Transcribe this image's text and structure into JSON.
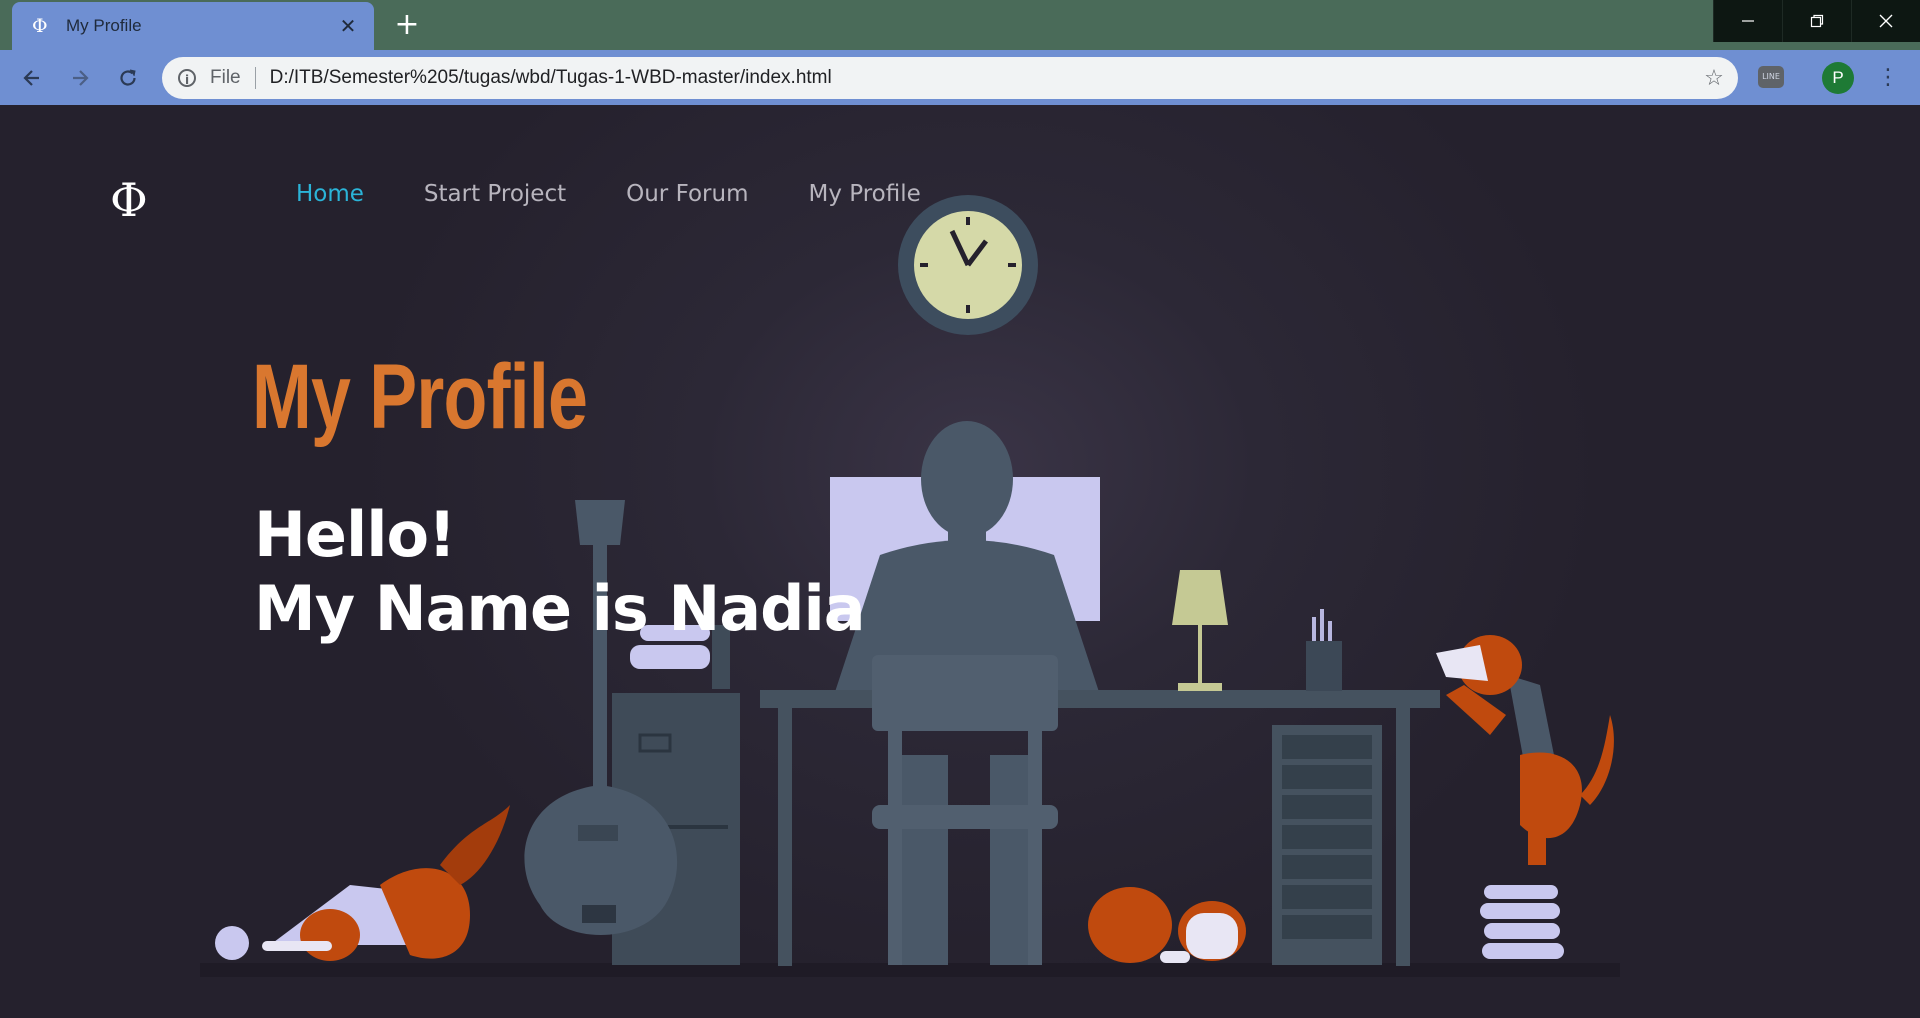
{
  "browser": {
    "tab_title": "My Profile",
    "tab_favicon": "Φ",
    "tab_close": "✕",
    "new_tab": "+",
    "address_scheme": "File",
    "address_url": "D:/ITB/Semester%205/tugas/wbd/Tugas-1-WBD-master/index.html",
    "profile_initial": "P",
    "icons": {
      "back": "arrow-left-icon",
      "forward": "arrow-right-icon",
      "reload": "reload-icon",
      "info": "info-icon",
      "star": "star-icon",
      "extension": "line-extension-icon",
      "menu": "vertical-dots-icon",
      "minimize": "minimize-icon",
      "maximize": "restore-icon",
      "close": "close-icon"
    },
    "accent_color": "#6f8fd2",
    "titlebar_color": "#4a6b59"
  },
  "site": {
    "logo": "Φ",
    "nav": [
      {
        "label": "Home",
        "active": true
      },
      {
        "label": "Start Project",
        "active": false
      },
      {
        "label": "Our Forum",
        "active": false
      },
      {
        "label": "My Profile",
        "active": false
      }
    ],
    "title": "My Profile",
    "greeting_line1": "Hello!",
    "greeting_line2": "My Name is Nadia",
    "colors": {
      "background": "#25212d",
      "title": "#d9772f",
      "nav_active": "#2bb4d8",
      "nav_inactive": "#b8b5be",
      "greeting": "#ffffff"
    }
  }
}
